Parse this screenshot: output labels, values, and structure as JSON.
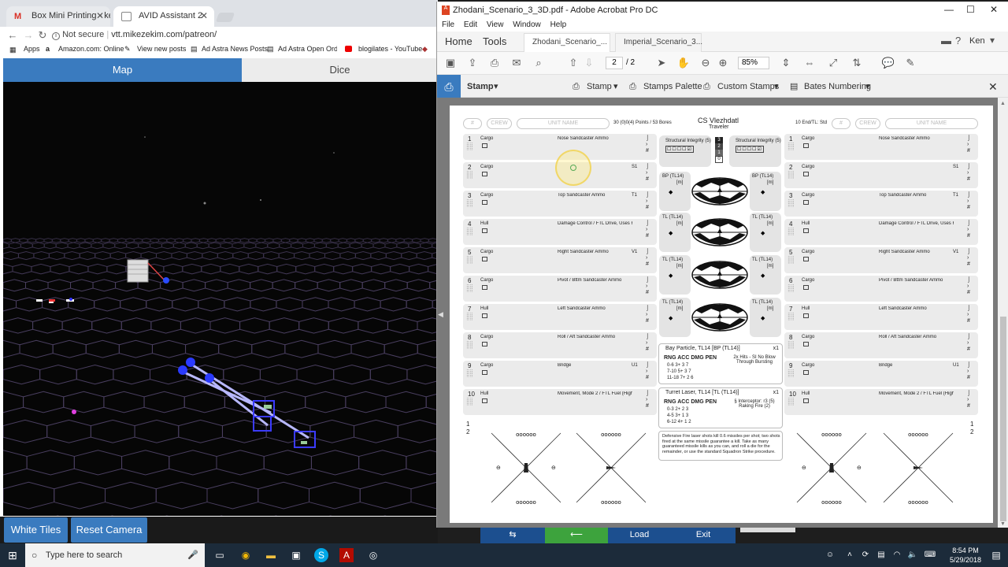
{
  "browser": {
    "tabs": [
      {
        "title": "Box Mini Printing - ken.b",
        "icon": "gmail-icon"
      },
      {
        "title": "AVID Assistant 2",
        "icon": "avid-icon"
      }
    ],
    "security_label": "Not secure",
    "url": "vtt.mikezekim.com/patreon/",
    "bookmarks": [
      "Apps",
      "Amazon.com: Online",
      "View new posts",
      "Ad Astra News Posts",
      "Ad Astra Open Orde",
      "blogilates - YouTube"
    ]
  },
  "vtt": {
    "tabs": [
      {
        "label": "Map",
        "active": true
      },
      {
        "label": "Dice",
        "active": false
      }
    ],
    "buttons": [
      "White Tiles",
      "Reset Camera"
    ],
    "colors": {
      "tab_active": "#3a7bbf",
      "tab_inactive": "#e9e9e9",
      "grid": "#4a3f60",
      "ship_blue": "#3a3aff"
    }
  },
  "acrobat": {
    "title": "Zhodani_Scenario_3_3D.pdf - Adobe Acrobat Pro DC",
    "menu": [
      "File",
      "Edit",
      "View",
      "Window",
      "Help"
    ],
    "nav": {
      "home": "Home",
      "tools": "Tools",
      "doc_tabs": [
        "Zhodani_Scenario_...",
        "Imperial_Scenario_3..."
      ],
      "user": "Ken"
    },
    "page_current": "2",
    "page_total": "/ 2",
    "zoom": "85%",
    "stamp_toolbar": {
      "title": "Stamp",
      "items": [
        "Stamp",
        "Stamps Palette",
        "Custom Stamps",
        "Bates Numbering"
      ]
    }
  },
  "sheet": {
    "header_left": {
      "hash": "#",
      "crew": "CREW",
      "unit_name": "UNIT NAME",
      "points": "30 (0)0(4) Points / 53 Bores"
    },
    "ship_name": "CS Vlezhdatl",
    "ship_class": "Traveler",
    "header_right": {
      "endurance": "10 End/TL: Std",
      "hash": "#",
      "crew": "CREW",
      "unit_name": "UNIT NAME"
    },
    "structural_integrity": "Structural Integrity (5)",
    "si_counter": [
      "3",
      "2",
      "1",
      "0"
    ],
    "rows": [
      {
        "num": "1",
        "left": "Cargo",
        "mid": "Nose Sandcaster Ammo",
        "code": ""
      },
      {
        "num": "2",
        "left": "Cargo",
        "mid": "",
        "code": "S1"
      },
      {
        "num": "3",
        "left": "Cargo",
        "mid": "Top Sandcaster Ammo",
        "code": "T1"
      },
      {
        "num": "4",
        "left": "Hull",
        "mid": "Damage Control / FTL Drive, Uses Fuel",
        "code": ""
      },
      {
        "num": "5",
        "left": "Cargo",
        "mid": "Right Sandcaster Ammo",
        "code": "V1"
      },
      {
        "num": "6",
        "left": "Cargo",
        "mid": "Pivot / Bttm Sandcaster Ammo",
        "code": ""
      },
      {
        "num": "7",
        "left": "Hull",
        "mid": "Left Sandcaster Ammo",
        "code": ""
      },
      {
        "num": "8",
        "left": "Cargo",
        "mid": "Roll / Aft Sandcaster Ammo",
        "code": ""
      },
      {
        "num": "9",
        "left": "Cargo",
        "mid": "Bridge",
        "code": "U1"
      },
      {
        "num": "10",
        "left": "Hull",
        "mid": "Movement, Mode 2 / FTL Fuel (High)",
        "code": ""
      }
    ],
    "bp_label": "BP (TL14)",
    "tl_label": "TL (TL14)",
    "mount_code": "[m]",
    "bay_weapon": {
      "name": "Bay Particle, TL14 [BP (TL14)]",
      "count": "x1",
      "headers": "RNG  ACC  DMG  PEN",
      "rows": [
        "0-6   3+   3   7",
        "7-10  5+   3   7",
        "11-18 7+   2   6"
      ],
      "notes": "2x Hits - SI No Blow Through Bursting"
    },
    "turret_weapon": {
      "name": "Turret Laser, TL14 [TL (TL14)]",
      "count": "x1",
      "headers": "RNG  ACC  DMG  PEN",
      "rows": [
        "0-3   2+   2   3",
        "4-5   3+   1   3",
        "6-12  4+   1   2"
      ],
      "notes": "§ Interceptor: r3 (5) Raking Fire (2)"
    },
    "defensive_note": "Defensive Fire laser shots kill 0.6 missiles per shot; two shots fired at the same missile guarantee a kill. Take as many guaranteed missile kills as you can, and roll a die for the remainder, or use the standard Squadron Strike procedure."
  },
  "taskbar": {
    "search_placeholder": "Type here to search",
    "time": "8:54 PM",
    "date": "5/29/2018"
  },
  "bottom_strip": [
    "",
    "",
    "Load",
    "Exit"
  ]
}
